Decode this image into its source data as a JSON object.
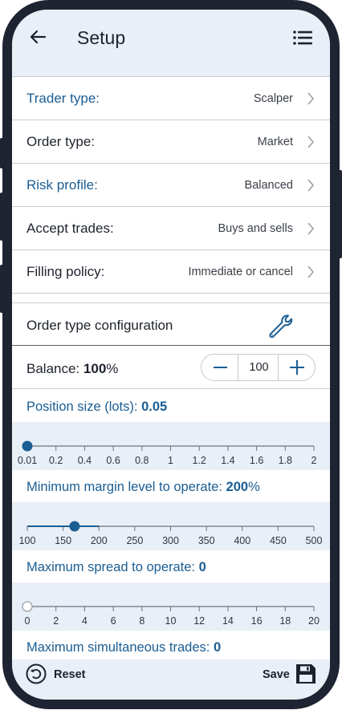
{
  "header": {
    "title": "Setup"
  },
  "settings": [
    {
      "label": "Trader type:",
      "value": "Scalper",
      "highlight": true
    },
    {
      "label": "Order type:",
      "value": "Market",
      "highlight": false
    },
    {
      "label": "Risk profile:",
      "value": "Balanced",
      "highlight": true
    },
    {
      "label": "Accept trades:",
      "value": "Buys and sells",
      "highlight": false
    },
    {
      "label": "Filling policy:",
      "value": "Immediate or cancel",
      "highlight": false
    }
  ],
  "config": {
    "label": "Order type configuration",
    "icon": "wrench-icon"
  },
  "balance": {
    "label": "Balance:",
    "value_bold": "100",
    "unit": "%",
    "stepper_value": "100"
  },
  "params": [
    {
      "label": "Position size (lots):",
      "value": "0.05",
      "unit": "",
      "ticks": [
        "0.01",
        "0.2",
        "0.4",
        "0.6",
        "0.8",
        "1",
        "1.2",
        "1.4",
        "1.6",
        "1.8",
        "2"
      ],
      "min": 0.01,
      "max": 2,
      "current": 0.01,
      "filled": true
    },
    {
      "label": "Minimum margin level to operate:",
      "value": "200",
      "unit": "%",
      "ticks": [
        "100",
        "150",
        "200",
        "250",
        "300",
        "350",
        "400",
        "450",
        "500"
      ],
      "min": 100,
      "max": 500,
      "current": 166,
      "filled": true
    },
    {
      "label": "Maximum spread to operate:",
      "value": "0",
      "unit": "",
      "ticks": [
        "0",
        "2",
        "4",
        "6",
        "8",
        "10",
        "12",
        "14",
        "16",
        "18",
        "20"
      ],
      "min": 0,
      "max": 20,
      "current": 0,
      "filled": false
    },
    {
      "label": "Maximum simultaneous trades:",
      "value": "0",
      "unit": ""
    }
  ],
  "footer": {
    "reset_label": "Reset",
    "save_label": "Save"
  },
  "colors": {
    "accent": "#1a5d93",
    "frame": "#1e2431",
    "surface": "#e9eff6"
  }
}
